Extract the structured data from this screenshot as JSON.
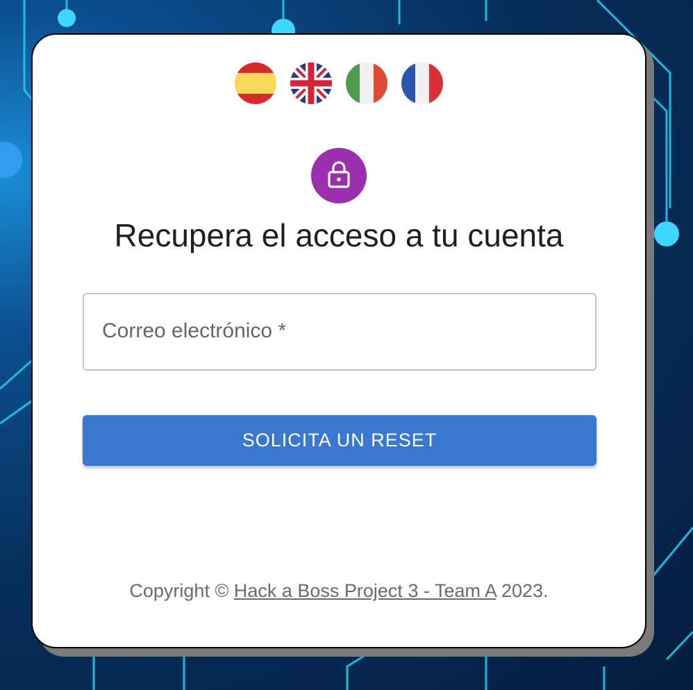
{
  "languages": [
    {
      "code": "es",
      "icon": "spain-flag-icon"
    },
    {
      "code": "en",
      "icon": "uk-flag-icon"
    },
    {
      "code": "it",
      "icon": "italy-flag-icon"
    },
    {
      "code": "fr",
      "icon": "france-flag-icon"
    }
  ],
  "avatar": {
    "icon": "lock-icon",
    "color": "#9c2fb0"
  },
  "page": {
    "title": "Recupera el acceso a tu cuenta"
  },
  "form": {
    "email_label": "Correo electrónico",
    "email_required_mark": " *",
    "email_value": "",
    "submit_label": "SOLICITA UN RESET",
    "submit_color": "#3a78d0"
  },
  "footer": {
    "prefix": "Copyright © ",
    "link_text": "Hack a Boss Project 3 - Team A",
    "suffix": " 2023."
  }
}
